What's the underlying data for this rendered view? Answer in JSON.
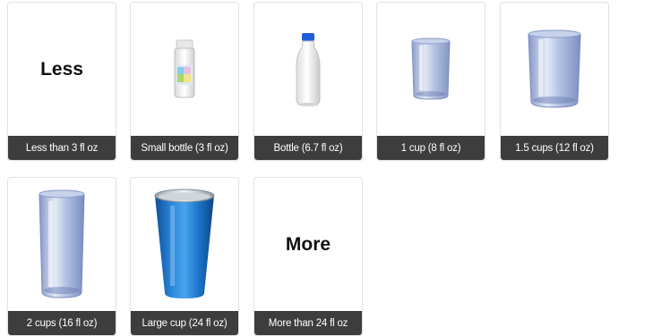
{
  "options": [
    {
      "label": "Less than 3 fl oz",
      "text": "Less",
      "icon": "less-text"
    },
    {
      "label": "Small bottle (3 fl oz)",
      "icon": "small-bottle-icon"
    },
    {
      "label": "Bottle (6.7 fl oz)",
      "icon": "bottle-icon"
    },
    {
      "label": "1 cup (8 fl oz)",
      "icon": "glass-icon"
    },
    {
      "label": "1.5 cups (12 fl oz)",
      "icon": "wide-glass-icon"
    },
    {
      "label": "2 cups (16 fl oz)",
      "icon": "tall-glass-icon"
    },
    {
      "label": "Large cup (24 fl oz)",
      "icon": "blue-cup-icon"
    },
    {
      "label": "More than 24 fl oz",
      "text": "More",
      "icon": "more-text"
    }
  ],
  "colors": {
    "caption_bg": "#3d3d3d",
    "caption_text": "#ffffff",
    "card_border": "#e2e2e2",
    "glass": "#9fb0d6",
    "cup_blue": "#1a73c8",
    "bottle_cap": "#1f5ed8"
  }
}
